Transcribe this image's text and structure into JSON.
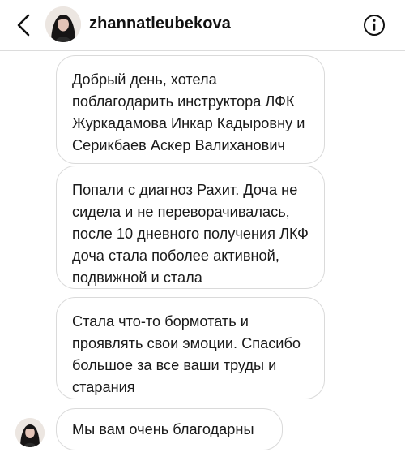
{
  "header": {
    "username": "zhannatleubekova",
    "back_icon": "chevron-left-icon",
    "info_icon": "info-icon",
    "avatar_icon": "avatar"
  },
  "messages": [
    {
      "lines": [
        "Добрый день, хотела",
        "поблагодарить инструктора  ЛФК",
        "Журкадамова Инкар Кадыровну и",
        "Серикбаев Аскер Валиханович"
      ]
    },
    {
      "lines": [
        "Попали с диагноз Рахит. Доча не",
        "сидела и не переворачивалась,",
        "после 10 дневного получения ЛКФ",
        "доча стала поболее активной,",
        "подвижной и стала"
      ]
    },
    {
      "lines": [
        "Стала что-то бормотать и",
        "проявлять свои эмоции. Спасибо",
        "большое за все ваши труды и",
        "старания"
      ]
    },
    {
      "lines": [
        "Мы вам очень благодарны"
      ]
    }
  ],
  "colors": {
    "bubble_border": "#dadada",
    "text": "#1a1a1a",
    "background": "#ffffff"
  }
}
